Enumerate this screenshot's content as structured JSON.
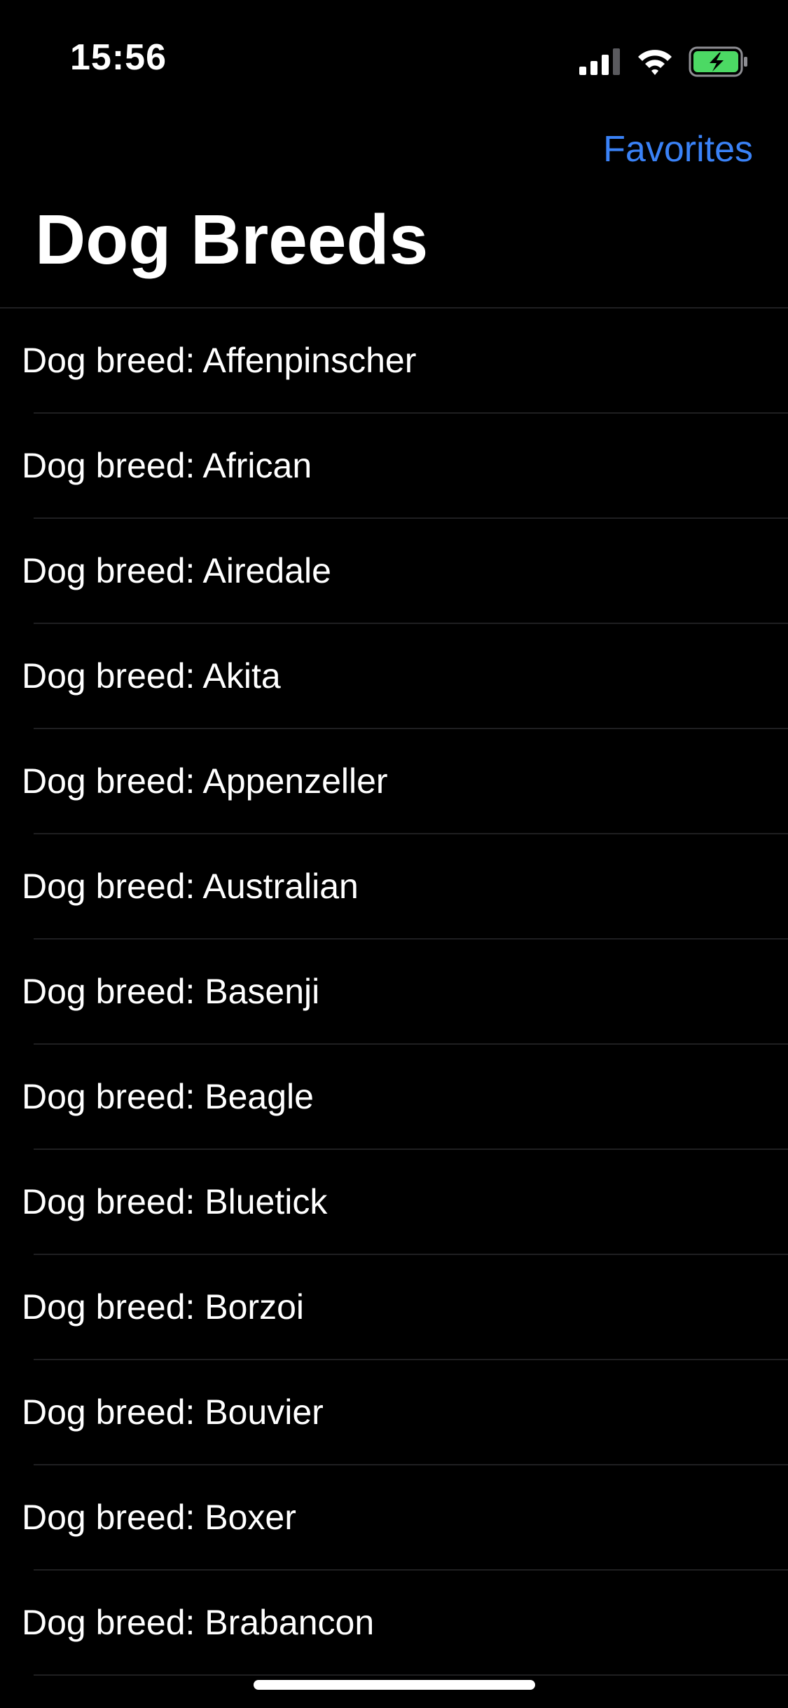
{
  "status_bar": {
    "time": "15:56",
    "battery_color": "#4cd964"
  },
  "nav": {
    "favorites_label": "Favorites",
    "title": "Dog Breeds",
    "accent_color": "#3a82f7"
  },
  "list": {
    "items": [
      {
        "label": "Dog breed: Affenpinscher"
      },
      {
        "label": "Dog breed: African"
      },
      {
        "label": "Dog breed: Airedale"
      },
      {
        "label": "Dog breed: Akita"
      },
      {
        "label": "Dog breed: Appenzeller"
      },
      {
        "label": "Dog breed: Australian"
      },
      {
        "label": "Dog breed: Basenji"
      },
      {
        "label": "Dog breed: Beagle"
      },
      {
        "label": "Dog breed: Bluetick"
      },
      {
        "label": "Dog breed: Borzoi"
      },
      {
        "label": "Dog breed: Bouvier"
      },
      {
        "label": "Dog breed: Boxer"
      },
      {
        "label": "Dog breed: Brabancon"
      }
    ]
  }
}
